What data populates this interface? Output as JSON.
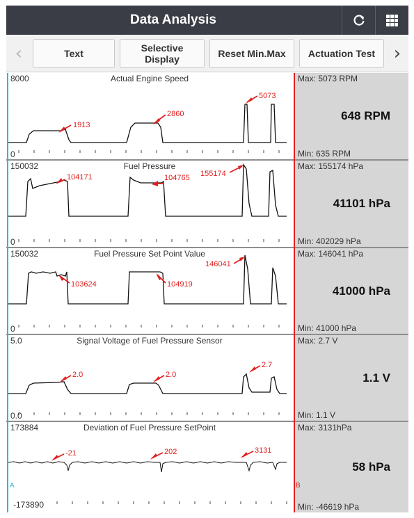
{
  "header": {
    "title": "Data Analysis",
    "refresh_icon": "refresh-icon",
    "grid_icon": "grid-icon"
  },
  "toolbar": {
    "buttons": [
      {
        "label": "Text"
      },
      {
        "label": "Selective Display"
      },
      {
        "label": "Reset Min.Max"
      },
      {
        "label": "Actuation Test"
      }
    ],
    "prev_glyph": "‹",
    "next_glyph": "›"
  },
  "cursors": {
    "a": "A",
    "b": "B"
  },
  "panels": [
    {
      "title": "Actual Engine Speed",
      "ymax": "8000",
      "ymin": "0",
      "max": "Max: 5073 RPM",
      "current": "648 RPM",
      "min": "Min: 635 RPM",
      "annotations": [
        "1913",
        "2860",
        "5073"
      ]
    },
    {
      "title": "Fuel Pressure",
      "ymax": "150032",
      "ymin": "0",
      "max": "Max: 155174 hPa",
      "current": "41101 hPa",
      "min": "Min: 402029 hPa",
      "annotations": [
        "104171",
        "104765",
        "155174"
      ]
    },
    {
      "title": "Fuel Pressure Set Point Value",
      "ymax": "150032",
      "ymin": "0",
      "max": "Max: 146041 hPa",
      "current": "41000 hPa",
      "min": "Min: 41000 hPa",
      "annotations": [
        "103624",
        "104919",
        "146041"
      ]
    },
    {
      "title": "Signal Voltage of Fuel Pressure Sensor",
      "ymax": "5.0",
      "ymin": "0.0",
      "max": "Max: 2.7 V",
      "current": "1.1 V",
      "min": "Min: 1.1 V",
      "annotations": [
        "2.0",
        "2.0",
        "2.7"
      ]
    },
    {
      "title": "Deviation of Fuel Pressure SetPoint",
      "ymax": "173884",
      "ymin": "-173890",
      "max": "Max: 3131hPa",
      "current": "58 hPa",
      "min": "Min: -46619 hPa",
      "annotations": [
        "-21",
        "202",
        "3131"
      ]
    }
  ],
  "colors": {
    "accent": "#e02020",
    "cursor_a": "#2bb8d6",
    "header_bg": "#3a3d45",
    "side_bg": "#d6d6d6"
  }
}
